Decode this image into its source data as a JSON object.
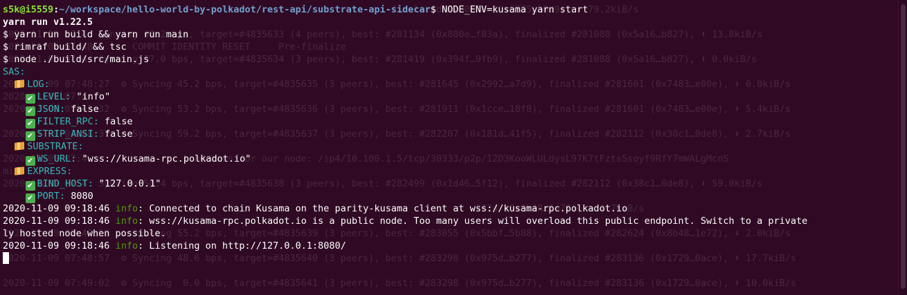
{
  "colors": {
    "background": "#300a24",
    "prompt_user": "#8ae234",
    "prompt_path": "#729fcf",
    "key_cyan": "#34b9ba",
    "info_green": "#4e9a06",
    "check_green": "#4caf50",
    "package_orange": "#e6a53a"
  },
  "prompt": {
    "user_host": "s5k@i5559",
    "sep": ":",
    "path": "~/workspace/hello-world-by-polkadot/rest-api/substrate-api-sidecar",
    "dollar": "$",
    "command": " NODE_ENV=kusama yarn start"
  },
  "yarn_version": "yarn run v1.22.5",
  "commands": [
    "$ yarn run build && yarn run main",
    "$ rimraf build/ && tsc",
    "$ node ./build/src/main.js"
  ],
  "config": {
    "root": "SAS:",
    "log": {
      "label": "LOG:",
      "level_key": "LEVEL:",
      "level_val": " \"info\"",
      "json_key": "JSON:",
      "json_val": " false",
      "filter_key": "FILTER_RPC:",
      "filter_val": " false",
      "strip_key": "STRIP_ANSI:",
      "strip_val": " false"
    },
    "substrate": {
      "label": "SUBSTRATE:",
      "ws_key": "WS_URL:",
      "ws_val": " \"wss://kusama-rpc.polkadot.io\""
    },
    "express": {
      "label": "EXPRESS:",
      "host_key": "BIND_HOST:",
      "host_val": " \"127.0.0.1\"",
      "port_key": "PORT:",
      "port_val": " 8080"
    }
  },
  "logs": [
    {
      "ts": "2020-11-09 09:18:46",
      "level": "info",
      "msg": ": Connected to chain Kusama on the parity-kusama client at wss://kusama-rpc.polkadot.io"
    },
    {
      "ts": "2020-11-09 09:18:46",
      "level": "info",
      "msg": ": wss://kusama-rpc.polkadot.io is a public node. Too many users will overload this public endpoint. Switch to a private"
    },
    {
      "ts": "",
      "level": "",
      "msg": "ly hosted node when possible."
    },
    {
      "ts": "2020-11-09 09:18:46",
      "level": "info",
      "msg": ": Listening on http://127.0.0.1:8080/"
    }
  ],
  "ghost_lines": [
    "                                                                     finalized #280576 (0x6875…30d9), ⬇ 79.2kiB/s",
    "2020-11-09 07:4  Syncing 43.2 bps, target=#4835633 (4 peers), best: #281134 (0x880e…f83a), finalized #281088 (0x5a16…b827), ⬇ 13.8kiB/s",
    "2020-11-09 07:48:      COMMIT IDENTITY RESET     Pre-finalize",
    "2020-11-09 07:4  Syncing 57.0 bps, target=#4835634 (3 peers), best: #281419 (0x394f…9fb9), finalized #281088 (0x5a16…b827), ⬇ 0.0kiB/s",
    "                                                                                                    ",
    "2020-11-09 07:48:27  ⚙ Syncing 45.2 bps, target=#4835635 (3 peers), best: #281645 (0x2992…a7d9), finalized #281601 (0x7483…e00e), ⬇ 0.0kiB/s",
    "2020-11-09 07:4     ",
    "2020-11-09 07:48:32  ⚙ Syncing 53.2 bps, target=#4835636 (3 peers), best: #281911 (0x1cce…18f8), finalized #281601 (0x7483…e00e), ⬇ 5.4kiB/s",
    "                                                                                                    ",
    "2020-11-09 07:48:37  ⚙ Syncing 59.2 bps, target=#4835637 (3 peers), best: #282207 (0x181d…41f5), finalized #282112 (0x38c1…0de8), ⬇ 2.7kiB/s",
    "                                                                                                    ",
    "2020-11-09 07:4                 l address for our node: /ip4/10.100.1.5/tcp/30333/p2p/12D3KooWLULdysL97K7tFzts5soyf9RfY7mWALgMcnS",
    "mi                                                                                                  ",
    "2020-11-09 07:4  Syncing 58.4 bps, target=#4835638 (3 peers), best: #282499 (0x1d46…5f12), finalized #282112 (0x38c1…0de8), ⬇ 59.0kiB/s",
    "                                                                                                    ",
    "2020-11-09 07:48:4                                                                  2624 (0x8b48…1e72), ⬇ 4.7kiB/s",
    "2020-11-09 07:48:52  ⚙ Syncing 55.2 bps, target=#4835639 (3 peers), best: #283055 (0x5bbf…5b88), finalized #282624 (0x8b48…1e72), ⬇ 2.0kiB/s",
    "                                                                                                    ",
    "2020-11-09 07:48:57  ⚙ Syncing 48.6 bps, target=#4835640 (3 peers), best: #283298 (0x975d…b277), finalized #283136 (0x1729…0ace), ⬇ 17.7kiB/s",
    "                                                                                                    ",
    "2020-11-09 07:49:02  ⚙ Syncing  0.0 bps, target=#4835641 (3 peers), best: #283298 (0x975d…b277), finalized #283136 (0x1729…0ace), ⬇ 10.0kiB/s"
  ]
}
